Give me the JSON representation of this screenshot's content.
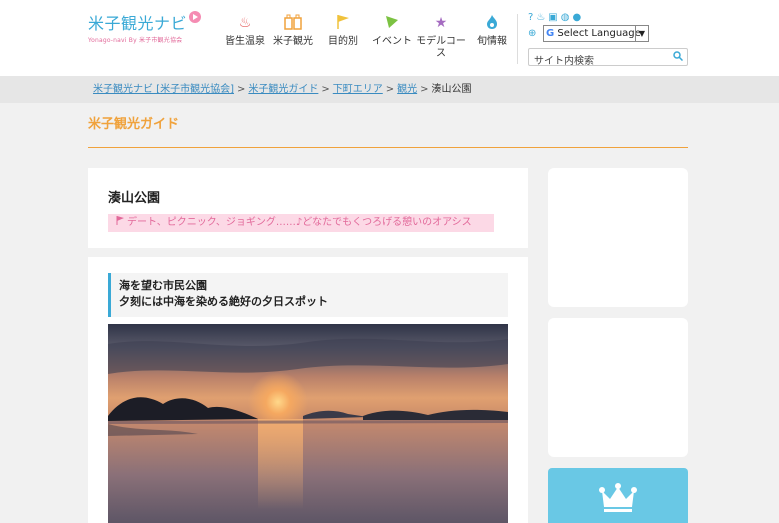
{
  "header": {
    "logo_title": "米子観光ナビ",
    "logo_sub": "Yonago-navi By 米子市観光協会",
    "nav": [
      {
        "label": "皆生温泉",
        "icon": "hot-spring-icon",
        "glyph": "♨",
        "color": "#e55a5a"
      },
      {
        "label": "米子観光",
        "icon": "luggage-icon",
        "glyph": "▥",
        "color": "#f0a23c"
      },
      {
        "label": "目的別",
        "icon": "flag-icon",
        "glyph": "⚑",
        "color": "#f0c23c"
      },
      {
        "label": "イベント",
        "icon": "party-flag-icon",
        "glyph": "◣",
        "color": "#7cc242"
      },
      {
        "label": "モデルコース",
        "icon": "star-icon",
        "glyph": "★",
        "color": "#a56cc1"
      },
      {
        "label": "旬情報",
        "icon": "flame-icon",
        "glyph": "●",
        "color": "#3aa9d6"
      }
    ],
    "util": {
      "lang_label": "Select Language",
      "search_placeholder": "サイト内検索"
    }
  },
  "breadcrumb": {
    "links": [
      "米子観光ナビ [米子市観光協会]",
      "米子観光ガイド",
      "下町エリア",
      "観光"
    ],
    "current": "湊山公園"
  },
  "section_title": "米子観光ガイド",
  "article": {
    "title": "湊山公園",
    "catch": "デート、ピクニック、ジョギング……♪どなたでもくつろげる憩いのオアシス",
    "lead_line1": "海を望む市民公園",
    "lead_line2": "夕刻には中海を染める絶好の夕日スポット"
  },
  "colors": {
    "accent_blue": "#3aa9d6",
    "accent_orange": "#f0a23c",
    "accent_pink": "#e2699a"
  }
}
